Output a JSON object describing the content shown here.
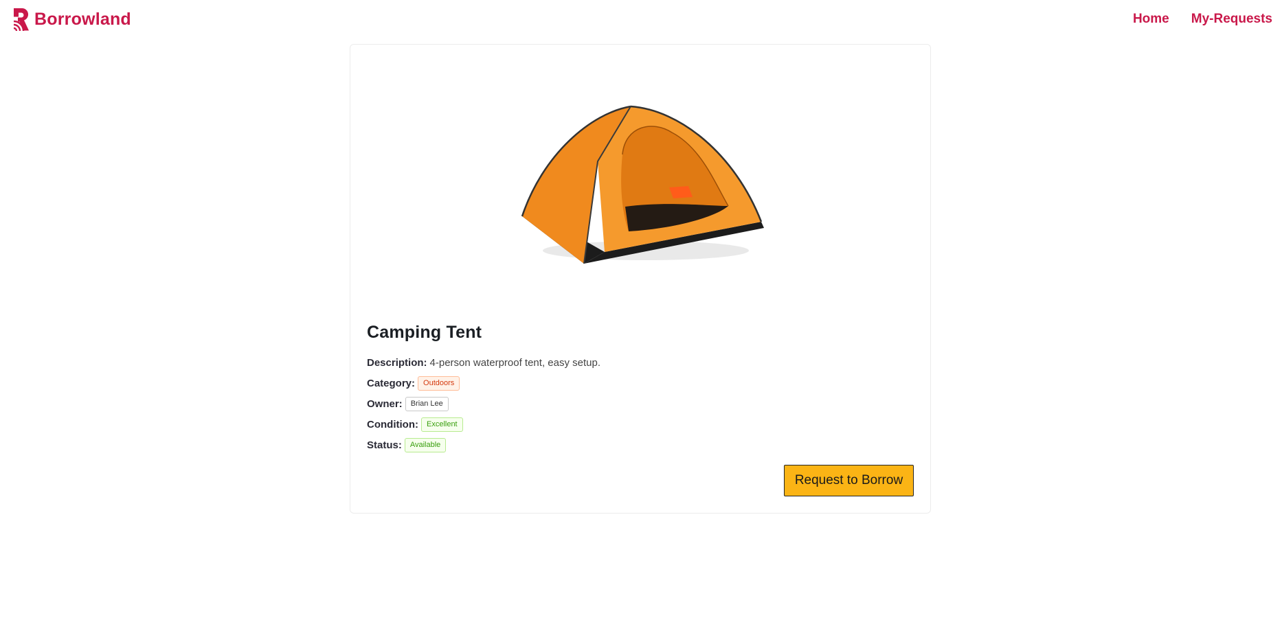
{
  "app": {
    "brand_name": "Borrowland",
    "brand_color": "#c9184a",
    "logo_icon": "borrowland-logo-icon"
  },
  "nav": {
    "links": [
      {
        "label": "Home"
      },
      {
        "label": "My-Requests"
      }
    ]
  },
  "item": {
    "image_icon": "tent-image",
    "title": "Camping Tent",
    "description_label": "Description:",
    "description": "4-person waterproof tent, easy setup.",
    "category_label": "Category:",
    "category": "Outdoors",
    "owner_label": "Owner:",
    "owner": "Brian Lee",
    "condition_label": "Condition:",
    "condition": "Excellent",
    "status_label": "Status:",
    "status": "Available"
  },
  "actions": {
    "request_label": "Request to Borrow",
    "request_color": "#fbb415"
  }
}
